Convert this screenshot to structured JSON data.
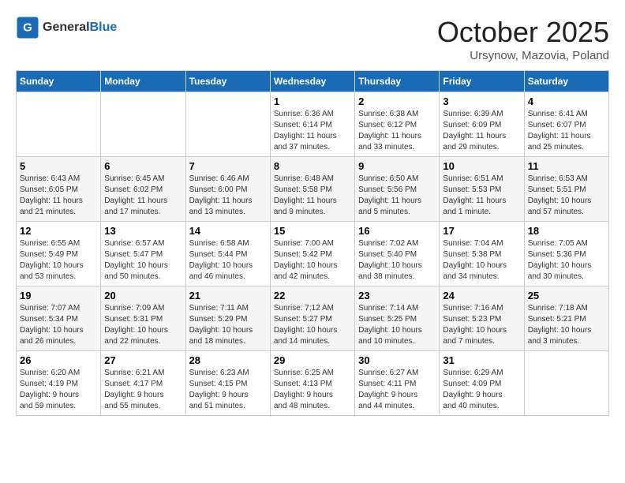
{
  "header": {
    "logo_general": "General",
    "logo_blue": "Blue",
    "month_title": "October 2025",
    "location": "Ursynow, Mazovia, Poland"
  },
  "weekdays": [
    "Sunday",
    "Monday",
    "Tuesday",
    "Wednesday",
    "Thursday",
    "Friday",
    "Saturday"
  ],
  "weeks": [
    [
      {
        "day": "",
        "info": ""
      },
      {
        "day": "",
        "info": ""
      },
      {
        "day": "",
        "info": ""
      },
      {
        "day": "1",
        "info": "Sunrise: 6:36 AM\nSunset: 6:14 PM\nDaylight: 11 hours\nand 37 minutes."
      },
      {
        "day": "2",
        "info": "Sunrise: 6:38 AM\nSunset: 6:12 PM\nDaylight: 11 hours\nand 33 minutes."
      },
      {
        "day": "3",
        "info": "Sunrise: 6:39 AM\nSunset: 6:09 PM\nDaylight: 11 hours\nand 29 minutes."
      },
      {
        "day": "4",
        "info": "Sunrise: 6:41 AM\nSunset: 6:07 PM\nDaylight: 11 hours\nand 25 minutes."
      }
    ],
    [
      {
        "day": "5",
        "info": "Sunrise: 6:43 AM\nSunset: 6:05 PM\nDaylight: 11 hours\nand 21 minutes."
      },
      {
        "day": "6",
        "info": "Sunrise: 6:45 AM\nSunset: 6:02 PM\nDaylight: 11 hours\nand 17 minutes."
      },
      {
        "day": "7",
        "info": "Sunrise: 6:46 AM\nSunset: 6:00 PM\nDaylight: 11 hours\nand 13 minutes."
      },
      {
        "day": "8",
        "info": "Sunrise: 6:48 AM\nSunset: 5:58 PM\nDaylight: 11 hours\nand 9 minutes."
      },
      {
        "day": "9",
        "info": "Sunrise: 6:50 AM\nSunset: 5:56 PM\nDaylight: 11 hours\nand 5 minutes."
      },
      {
        "day": "10",
        "info": "Sunrise: 6:51 AM\nSunset: 5:53 PM\nDaylight: 11 hours\nand 1 minute."
      },
      {
        "day": "11",
        "info": "Sunrise: 6:53 AM\nSunset: 5:51 PM\nDaylight: 10 hours\nand 57 minutes."
      }
    ],
    [
      {
        "day": "12",
        "info": "Sunrise: 6:55 AM\nSunset: 5:49 PM\nDaylight: 10 hours\nand 53 minutes."
      },
      {
        "day": "13",
        "info": "Sunrise: 6:57 AM\nSunset: 5:47 PM\nDaylight: 10 hours\nand 50 minutes."
      },
      {
        "day": "14",
        "info": "Sunrise: 6:58 AM\nSunset: 5:44 PM\nDaylight: 10 hours\nand 46 minutes."
      },
      {
        "day": "15",
        "info": "Sunrise: 7:00 AM\nSunset: 5:42 PM\nDaylight: 10 hours\nand 42 minutes."
      },
      {
        "day": "16",
        "info": "Sunrise: 7:02 AM\nSunset: 5:40 PM\nDaylight: 10 hours\nand 38 minutes."
      },
      {
        "day": "17",
        "info": "Sunrise: 7:04 AM\nSunset: 5:38 PM\nDaylight: 10 hours\nand 34 minutes."
      },
      {
        "day": "18",
        "info": "Sunrise: 7:05 AM\nSunset: 5:36 PM\nDaylight: 10 hours\nand 30 minutes."
      }
    ],
    [
      {
        "day": "19",
        "info": "Sunrise: 7:07 AM\nSunset: 5:34 PM\nDaylight: 10 hours\nand 26 minutes."
      },
      {
        "day": "20",
        "info": "Sunrise: 7:09 AM\nSunset: 5:31 PM\nDaylight: 10 hours\nand 22 minutes."
      },
      {
        "day": "21",
        "info": "Sunrise: 7:11 AM\nSunset: 5:29 PM\nDaylight: 10 hours\nand 18 minutes."
      },
      {
        "day": "22",
        "info": "Sunrise: 7:12 AM\nSunset: 5:27 PM\nDaylight: 10 hours\nand 14 minutes."
      },
      {
        "day": "23",
        "info": "Sunrise: 7:14 AM\nSunset: 5:25 PM\nDaylight: 10 hours\nand 10 minutes."
      },
      {
        "day": "24",
        "info": "Sunrise: 7:16 AM\nSunset: 5:23 PM\nDaylight: 10 hours\nand 7 minutes."
      },
      {
        "day": "25",
        "info": "Sunrise: 7:18 AM\nSunset: 5:21 PM\nDaylight: 10 hours\nand 3 minutes."
      }
    ],
    [
      {
        "day": "26",
        "info": "Sunrise: 6:20 AM\nSunset: 4:19 PM\nDaylight: 9 hours\nand 59 minutes."
      },
      {
        "day": "27",
        "info": "Sunrise: 6:21 AM\nSunset: 4:17 PM\nDaylight: 9 hours\nand 55 minutes."
      },
      {
        "day": "28",
        "info": "Sunrise: 6:23 AM\nSunset: 4:15 PM\nDaylight: 9 hours\nand 51 minutes."
      },
      {
        "day": "29",
        "info": "Sunrise: 6:25 AM\nSunset: 4:13 PM\nDaylight: 9 hours\nand 48 minutes."
      },
      {
        "day": "30",
        "info": "Sunrise: 6:27 AM\nSunset: 4:11 PM\nDaylight: 9 hours\nand 44 minutes."
      },
      {
        "day": "31",
        "info": "Sunrise: 6:29 AM\nSunset: 4:09 PM\nDaylight: 9 hours\nand 40 minutes."
      },
      {
        "day": "",
        "info": ""
      }
    ]
  ]
}
